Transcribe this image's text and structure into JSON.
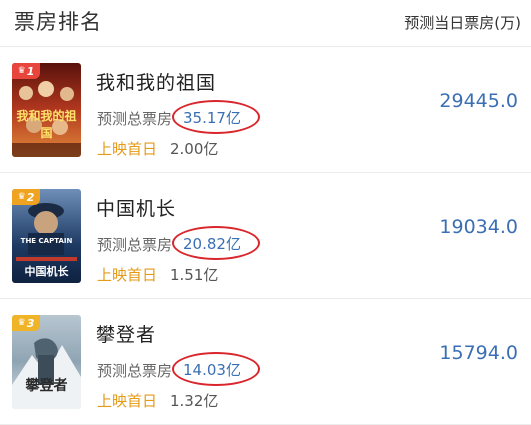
{
  "header": {
    "title": "票房排名",
    "subtitle": "预测当日票房(万)"
  },
  "movies": [
    {
      "rank": "1",
      "title": "我和我的祖国",
      "pred_label": "预测总票房",
      "pred_value": "35.17亿",
      "first_day_label": "上映首日",
      "first_day_value": "2.00亿",
      "daily": "29445.0",
      "poster_text": "我和我的祖国",
      "badge_color": "#e8453c",
      "poster_colors": [
        "#7a1a12",
        "#c8612a"
      ]
    },
    {
      "rank": "2",
      "title": "中国机长",
      "pred_label": "预测总票房",
      "pred_value": "20.82亿",
      "first_day_label": "上映首日",
      "first_day_value": "1.51亿",
      "daily": "19034.0",
      "poster_text": "中国机长",
      "poster_text_en": "THE CAPTAIN",
      "badge_color": "#f0a321",
      "poster_colors": [
        "#1d3a63",
        "#4a7ab0"
      ]
    },
    {
      "rank": "3",
      "title": "攀登者",
      "pred_label": "预测总票房",
      "pred_value": "14.03亿",
      "first_day_label": "上映首日",
      "first_day_value": "1.32亿",
      "daily": "15794.0",
      "poster_text": "攀登者",
      "badge_color": "#f0b429",
      "poster_colors": [
        "#8fa4b3",
        "#d7e0e6"
      ]
    }
  ],
  "colors": {
    "accent_blue": "#3a6fb3",
    "first_day_orange": "#e59a18",
    "highlight_ring": "#d9262c"
  }
}
